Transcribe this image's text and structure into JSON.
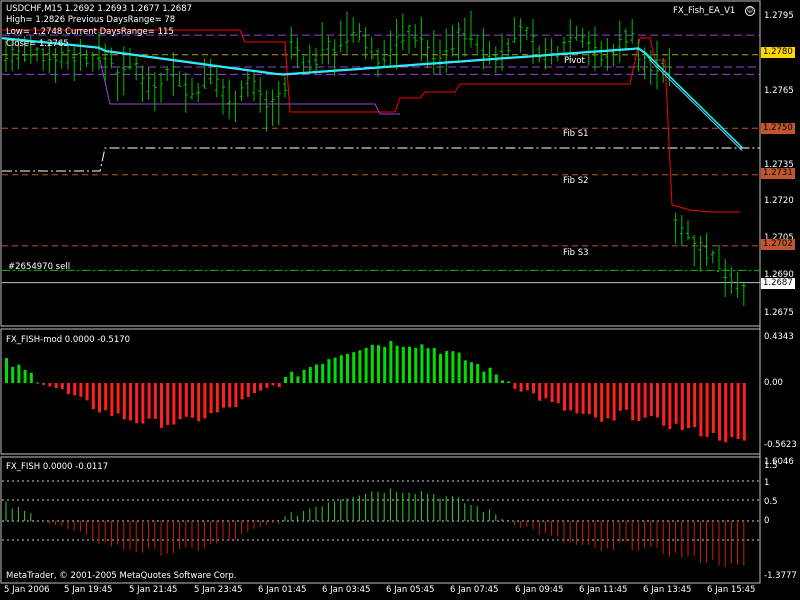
{
  "chart_data": [
    {
      "type": "line",
      "title": "USDCHF,M15",
      "ohlc_header": "USDCHF,M15  1.2692 1.2693 1.2677 1.2687",
      "info_lines": [
        "High= 1.2826 Previous DaysRange= 78",
        "Low= 1.2748 Current DaysRange= 115",
        "Close= 1.2765"
      ],
      "expert_label": "FX_Fish_EA_V1",
      "order_label": "#2654970 sell",
      "y_ticks": [
        "1.2795",
        "1.2765",
        "1.2735",
        "1.2720",
        "1.2705",
        "1.2690",
        "1.2675"
      ],
      "ylim": [
        1.267,
        1.28
      ],
      "price_boxes": [
        {
          "value": "1.2780",
          "bg": "#ffd700",
          "fg": "#000000"
        },
        {
          "value": "1.2750",
          "bg": "#c0562f",
          "fg": "#000000"
        },
        {
          "value": "1.2731",
          "bg": "#c0562f",
          "fg": "#000000"
        },
        {
          "value": "1.2702",
          "bg": "#c0562f",
          "fg": "#000000"
        },
        {
          "value": "1.2687",
          "bg": "#ffffff",
          "fg": "#000000"
        }
      ],
      "levels": [
        {
          "name": "Pivot",
          "value": 1.278,
          "color": "#b8860b"
        },
        {
          "name": "Fib S1",
          "value": 1.275,
          "color": "#c0562f"
        },
        {
          "name": "Fib S2",
          "value": 1.2731,
          "color": "#c0562f"
        },
        {
          "name": "Fib S3",
          "value": 1.2702,
          "color": "#c0562f"
        }
      ],
      "colors": {
        "bars": "#00c000",
        "ma_fast": "#00ffff",
        "ma_slow": "#87cefa",
        "range": "#ff0000",
        "levels": "#8a2be2"
      }
    },
    {
      "type": "bar",
      "title": "FX_FISH-mod 0.0000 -0.5170",
      "y_ticks": [
        "0.4343",
        "0.00",
        "-0.5623"
      ],
      "ylim": [
        -0.5623,
        0.4343
      ],
      "colors": {
        "positive": "#00e000",
        "negative": "#ff2020"
      }
    },
    {
      "type": "bar",
      "title": "FX_FISH 0.0000 -0.0117",
      "y_ticks": [
        "1.5",
        "1",
        "0.5",
        "0",
        "-1.3777"
      ],
      "top_label": "1.6046",
      "ylim": [
        -1.3777,
        1.6046
      ],
      "colors": {
        "positive": "#33cc33",
        "negative": "#cc2200"
      }
    }
  ],
  "x_ticks": [
    "5 Jan 2006",
    "5 Jan 19:45",
    "5 Jan 21:45",
    "5 Jan 23:45",
    "6 Jan 01:45",
    "6 Jan 03:45",
    "6 Jan 05:45",
    "6 Jan 07:45",
    "6 Jan 09:45",
    "6 Jan 11:45",
    "6 Jan 13:45",
    "6 Jan 15:45"
  ],
  "copyright": "MetaQuotes Software Corp."
}
